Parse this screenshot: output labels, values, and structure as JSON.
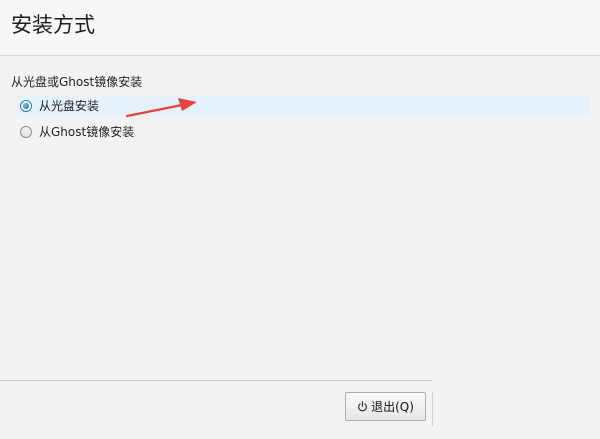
{
  "header": {
    "title": "安装方式"
  },
  "install_mode": {
    "group_label": "从光盘或Ghost镜像安装",
    "options": [
      {
        "label": "从光盘安装",
        "checked": true
      },
      {
        "label": "从Ghost镜像安装",
        "checked": false
      }
    ]
  },
  "footer": {
    "quit_label": "退出(Q)",
    "quit_icon": "power-icon"
  },
  "colors": {
    "selection_highlight": "#e5f1fb",
    "annotation_arrow": "#e8423f",
    "radio_accent": "#2c7ad6"
  }
}
